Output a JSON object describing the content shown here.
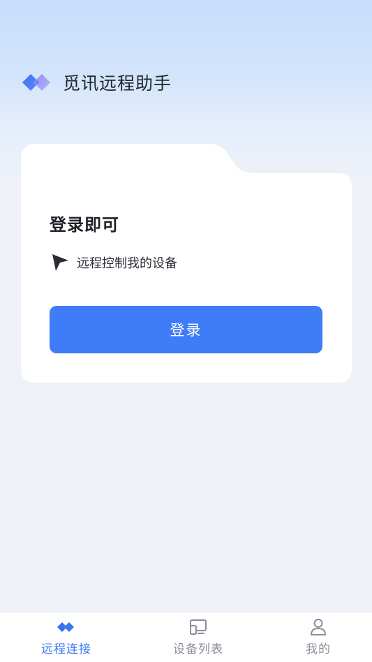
{
  "header": {
    "logo_icon": "double-diamond-logo-icon",
    "title": "觅讯远程助手"
  },
  "card": {
    "title": "登录即可",
    "feature_icon": "cursor-arrow-icon",
    "feature_text": "远程控制我的设备",
    "login_label": "登录"
  },
  "tabbar": {
    "tabs": [
      {
        "label": "远程连接",
        "icon": "remote-connect-icon",
        "active": true
      },
      {
        "label": "设备列表",
        "icon": "device-list-icon",
        "active": false
      },
      {
        "label": "我的",
        "icon": "user-icon",
        "active": false
      }
    ]
  },
  "colors": {
    "accent": "#3f7cf7",
    "active_tab": "#3a78f2",
    "inactive_tab": "#8a8f97",
    "title_text": "#222831"
  }
}
